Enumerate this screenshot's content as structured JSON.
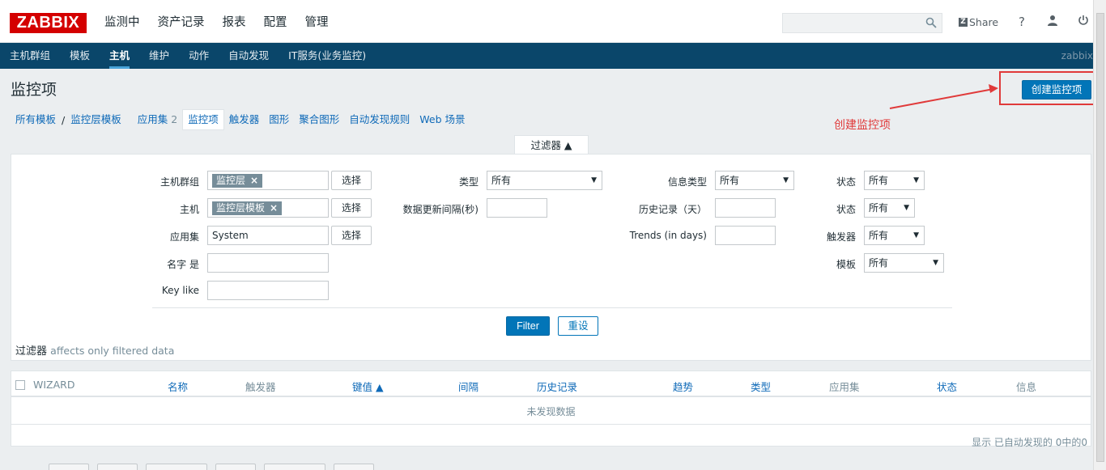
{
  "header": {
    "logo": "ZABBIX",
    "nav": [
      "监测中",
      "资产记录",
      "报表",
      "配置",
      "管理"
    ],
    "search": {
      "value": "",
      "placeholder": ""
    },
    "share_label": "Share",
    "help_icon": "question-icon",
    "user_icon": "user-icon",
    "logout_icon": "power-icon"
  },
  "subnav": {
    "items": [
      "主机群组",
      "模板",
      "主机",
      "维护",
      "动作",
      "自动发现",
      "IT服务(业务监控)"
    ],
    "active": "主机",
    "user": "zabbix"
  },
  "page": {
    "title": "监控项",
    "create_button": "创建监控项"
  },
  "annotation": {
    "label": "创建监控项",
    "color": "#e03a3a"
  },
  "breadcrumb": {
    "all_templates": "所有模板",
    "separator": "/",
    "template": "监控层模板",
    "apps": "应用集",
    "apps_count": "2",
    "items": "监控项",
    "triggers": "触发器",
    "graphs": "图形",
    "screens": "聚合图形",
    "discovery": "自动发现规则",
    "web": "Web 场景"
  },
  "filter": {
    "tab_label": "过滤器 ▲",
    "host_group_label": "主机群组",
    "host_group_chip": "监控层",
    "host_label": "主机",
    "host_chip": "监控层模板",
    "app_label": "应用集",
    "app_value": "System",
    "name_label": "名字 是",
    "name_value": "",
    "key_label": "Key like",
    "key_value": "",
    "select_button": "选择",
    "type_label": "类型",
    "type_value": "所有",
    "interval_label": "数据更新间隔(秒)",
    "interval_value": "",
    "info_type_label": "信息类型",
    "info_type_value": "所有",
    "history_label": "历史记录（天）",
    "history_value": "",
    "trends_label": "Trends (in days)",
    "trends_value": "",
    "state_label": "状态",
    "state_value": "所有",
    "status_label": "状态",
    "status_value": "所有",
    "triggers_label": "触发器",
    "triggers_value": "所有",
    "template_label": "模板",
    "template_value": "所有",
    "filter_button": "Filter",
    "reset_button": "重设",
    "note_title": "过滤器",
    "note_text": "affects only filtered data"
  },
  "table": {
    "columns": [
      "WIZARD",
      "名称",
      "触发器",
      "键值 ▲",
      "间隔",
      "历史记录",
      "趋势",
      "类型",
      "应用集",
      "状态",
      "信息"
    ],
    "empty_text": "未发现数据",
    "summary": "显示 已自动发现的 0中的0"
  },
  "colors": {
    "brand_red": "#d40000",
    "subnav_bg": "#0a466a",
    "primary_blue": "#0275b8",
    "link_blue": "#0f6ab8"
  }
}
